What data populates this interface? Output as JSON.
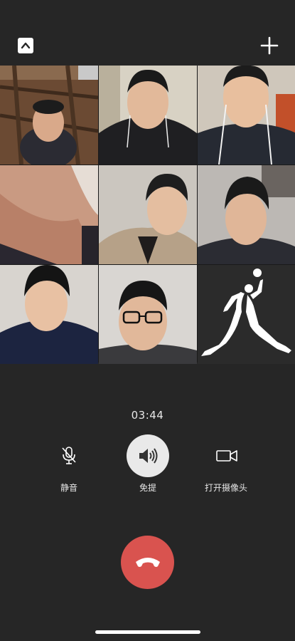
{
  "header": {
    "collapse_icon": "chevron-up-icon",
    "add_icon": "plus-icon"
  },
  "participants": [
    {
      "tile": "participant-1",
      "kind": "camera"
    },
    {
      "tile": "participant-2",
      "kind": "camera"
    },
    {
      "tile": "participant-3",
      "kind": "camera"
    },
    {
      "tile": "participant-4",
      "kind": "camera"
    },
    {
      "tile": "participant-5",
      "kind": "camera"
    },
    {
      "tile": "participant-6",
      "kind": "camera"
    },
    {
      "tile": "participant-7",
      "kind": "camera"
    },
    {
      "tile": "participant-8",
      "kind": "camera"
    },
    {
      "tile": "participant-9",
      "kind": "avatar-jumpman-logo"
    }
  ],
  "call": {
    "duration": "03:44"
  },
  "controls": {
    "mute_label": "静音",
    "speaker_label": "免提",
    "camera_label": "打开摄像头"
  },
  "colors": {
    "background": "#262626",
    "hangup": "#d9534f",
    "speaker_active": "#e9e9e9"
  }
}
